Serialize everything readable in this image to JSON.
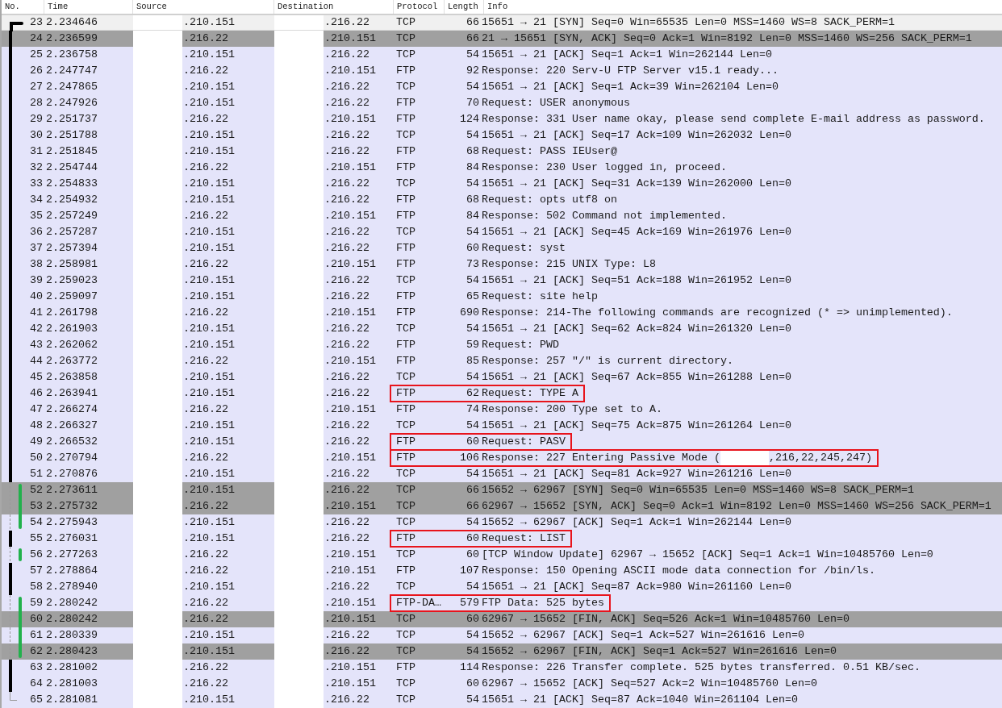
{
  "columns": [
    "No.",
    "Time",
    "Source",
    "Destination",
    "Protocol",
    "Length",
    "Info"
  ],
  "packets": [
    {
      "no": "23",
      "time": "2.234646",
      "source": ".210.151",
      "destination": ".216.22",
      "protocol": "TCP",
      "length": "66",
      "info": "15651 → 21 [SYN] Seq=0 Win=65535 Len=0 MSS=1460 WS=8 SACK_PERM=1",
      "color": "#f0f0f0",
      "selected": true,
      "highlighted": false,
      "kind": "start"
    },
    {
      "no": "24",
      "time": "2.236599",
      "source": ".216.22",
      "destination": ".210.151",
      "protocol": "TCP",
      "length": "66",
      "info": "21 → 15651 [SYN, ACK] Seq=0 Ack=1 Win=8192 Len=0 MSS=1460 WS=256 SACK_PERM=1",
      "color": "#a0a0a0",
      "selected": false,
      "highlighted": false,
      "kind": "same"
    },
    {
      "no": "25",
      "time": "2.236758",
      "source": ".210.151",
      "destination": ".216.22",
      "protocol": "TCP",
      "length": "54",
      "info": "15651 → 21 [ACK] Seq=1 Ack=1 Win=262144 Len=0",
      "color": "#e4e4fa",
      "selected": false,
      "highlighted": false,
      "kind": "same"
    },
    {
      "no": "26",
      "time": "2.247747",
      "source": ".216.22",
      "destination": ".210.151",
      "protocol": "FTP",
      "length": "92",
      "info": "Response: 220 Serv-U FTP Server v15.1 ready...",
      "color": "#e4e4fa",
      "selected": false,
      "highlighted": false,
      "kind": "same"
    },
    {
      "no": "27",
      "time": "2.247865",
      "source": ".210.151",
      "destination": ".216.22",
      "protocol": "TCP",
      "length": "54",
      "info": "15651 → 21 [ACK] Seq=1 Ack=39 Win=262104 Len=0",
      "color": "#e4e4fa",
      "selected": false,
      "highlighted": false,
      "kind": "same"
    },
    {
      "no": "28",
      "time": "2.247926",
      "source": ".210.151",
      "destination": ".216.22",
      "protocol": "FTP",
      "length": "70",
      "info": "Request: USER anonymous",
      "color": "#e4e4fa",
      "selected": false,
      "highlighted": false,
      "kind": "same"
    },
    {
      "no": "29",
      "time": "2.251737",
      "source": ".216.22",
      "destination": ".210.151",
      "protocol": "FTP",
      "length": "124",
      "info": "Response: 331 User name okay, please send complete E-mail address as password.",
      "color": "#e4e4fa",
      "selected": false,
      "highlighted": false,
      "kind": "same"
    },
    {
      "no": "30",
      "time": "2.251788",
      "source": ".210.151",
      "destination": ".216.22",
      "protocol": "TCP",
      "length": "54",
      "info": "15651 → 21 [ACK] Seq=17 Ack=109 Win=262032 Len=0",
      "color": "#e4e4fa",
      "selected": false,
      "highlighted": false,
      "kind": "same"
    },
    {
      "no": "31",
      "time": "2.251845",
      "source": ".210.151",
      "destination": ".216.22",
      "protocol": "FTP",
      "length": "68",
      "info": "Request: PASS IEUser@",
      "color": "#e4e4fa",
      "selected": false,
      "highlighted": false,
      "kind": "same"
    },
    {
      "no": "32",
      "time": "2.254744",
      "source": ".216.22",
      "destination": ".210.151",
      "protocol": "FTP",
      "length": "84",
      "info": "Response: 230 User logged in, proceed.",
      "color": "#e4e4fa",
      "selected": false,
      "highlighted": false,
      "kind": "same"
    },
    {
      "no": "33",
      "time": "2.254833",
      "source": ".210.151",
      "destination": ".216.22",
      "protocol": "TCP",
      "length": "54",
      "info": "15651 → 21 [ACK] Seq=31 Ack=139 Win=262000 Len=0",
      "color": "#e4e4fa",
      "selected": false,
      "highlighted": false,
      "kind": "same"
    },
    {
      "no": "34",
      "time": "2.254932",
      "source": ".210.151",
      "destination": ".216.22",
      "protocol": "FTP",
      "length": "68",
      "info": "Request: opts utf8 on",
      "color": "#e4e4fa",
      "selected": false,
      "highlighted": false,
      "kind": "same"
    },
    {
      "no": "35",
      "time": "2.257249",
      "source": ".216.22",
      "destination": ".210.151",
      "protocol": "FTP",
      "length": "84",
      "info": "Response: 502 Command not implemented.",
      "color": "#e4e4fa",
      "selected": false,
      "highlighted": false,
      "kind": "same"
    },
    {
      "no": "36",
      "time": "2.257287",
      "source": ".210.151",
      "destination": ".216.22",
      "protocol": "TCP",
      "length": "54",
      "info": "15651 → 21 [ACK] Seq=45 Ack=169 Win=261976 Len=0",
      "color": "#e4e4fa",
      "selected": false,
      "highlighted": false,
      "kind": "same"
    },
    {
      "no": "37",
      "time": "2.257394",
      "source": ".210.151",
      "destination": ".216.22",
      "protocol": "FTP",
      "length": "60",
      "info": "Request: syst",
      "color": "#e4e4fa",
      "selected": false,
      "highlighted": false,
      "kind": "same"
    },
    {
      "no": "38",
      "time": "2.258981",
      "source": ".216.22",
      "destination": ".210.151",
      "protocol": "FTP",
      "length": "73",
      "info": "Response: 215 UNIX Type: L8",
      "color": "#e4e4fa",
      "selected": false,
      "highlighted": false,
      "kind": "same"
    },
    {
      "no": "39",
      "time": "2.259023",
      "source": ".210.151",
      "destination": ".216.22",
      "protocol": "TCP",
      "length": "54",
      "info": "15651 → 21 [ACK] Seq=51 Ack=188 Win=261952 Len=0",
      "color": "#e4e4fa",
      "selected": false,
      "highlighted": false,
      "kind": "same"
    },
    {
      "no": "40",
      "time": "2.259097",
      "source": ".210.151",
      "destination": ".216.22",
      "protocol": "FTP",
      "length": "65",
      "info": "Request: site help",
      "color": "#e4e4fa",
      "selected": false,
      "highlighted": false,
      "kind": "same"
    },
    {
      "no": "41",
      "time": "2.261798",
      "source": ".216.22",
      "destination": ".210.151",
      "protocol": "FTP",
      "length": "690",
      "info": "Response: 214-The following commands are recognized (* => unimplemented).",
      "color": "#e4e4fa",
      "selected": false,
      "highlighted": false,
      "kind": "same"
    },
    {
      "no": "42",
      "time": "2.261903",
      "source": ".210.151",
      "destination": ".216.22",
      "protocol": "TCP",
      "length": "54",
      "info": "15651 → 21 [ACK] Seq=62 Ack=824 Win=261320 Len=0",
      "color": "#e4e4fa",
      "selected": false,
      "highlighted": false,
      "kind": "same"
    },
    {
      "no": "43",
      "time": "2.262062",
      "source": ".210.151",
      "destination": ".216.22",
      "protocol": "FTP",
      "length": "59",
      "info": "Request: PWD",
      "color": "#e4e4fa",
      "selected": false,
      "highlighted": false,
      "kind": "same"
    },
    {
      "no": "44",
      "time": "2.263772",
      "source": ".216.22",
      "destination": ".210.151",
      "protocol": "FTP",
      "length": "85",
      "info": "Response: 257 \"/\" is current directory.",
      "color": "#e4e4fa",
      "selected": false,
      "highlighted": false,
      "kind": "same"
    },
    {
      "no": "45",
      "time": "2.263858",
      "source": ".210.151",
      "destination": ".216.22",
      "protocol": "TCP",
      "length": "54",
      "info": "15651 → 21 [ACK] Seq=67 Ack=855 Win=261288 Len=0",
      "color": "#e4e4fa",
      "selected": false,
      "highlighted": false,
      "kind": "same"
    },
    {
      "no": "46",
      "time": "2.263941",
      "source": ".210.151",
      "destination": ".216.22",
      "protocol": "FTP",
      "length": "62",
      "info": "Request: TYPE A",
      "color": "#e4e4fa",
      "selected": false,
      "highlighted": true,
      "kind": "same"
    },
    {
      "no": "47",
      "time": "2.266274",
      "source": ".216.22",
      "destination": ".210.151",
      "protocol": "FTP",
      "length": "74",
      "info": "Response: 200 Type set to A.",
      "color": "#e4e4fa",
      "selected": false,
      "highlighted": false,
      "kind": "same"
    },
    {
      "no": "48",
      "time": "2.266327",
      "source": ".210.151",
      "destination": ".216.22",
      "protocol": "TCP",
      "length": "54",
      "info": "15651 → 21 [ACK] Seq=75 Ack=875 Win=261264 Len=0",
      "color": "#e4e4fa",
      "selected": false,
      "highlighted": false,
      "kind": "same"
    },
    {
      "no": "49",
      "time": "2.266532",
      "source": ".210.151",
      "destination": ".216.22",
      "protocol": "FTP",
      "length": "60",
      "info": "Request: PASV",
      "color": "#e4e4fa",
      "selected": false,
      "highlighted": true,
      "kind": "same"
    },
    {
      "no": "50",
      "time": "2.270794",
      "source": ".216.22",
      "destination": ".210.151",
      "protocol": "FTP",
      "length": "106",
      "info": "Response: 227 Entering Passive Mode (",
      "info_tail": ",216,22,245,247)",
      "color": "#e4e4fa",
      "selected": false,
      "highlighted": true,
      "kind": "same"
    },
    {
      "no": "51",
      "time": "2.270876",
      "source": ".210.151",
      "destination": ".216.22",
      "protocol": "TCP",
      "length": "54",
      "info": "15651 → 21 [ACK] Seq=81 Ack=927 Win=261216 Len=0",
      "color": "#e4e4fa",
      "selected": false,
      "highlighted": false,
      "kind": "same"
    },
    {
      "no": "52",
      "time": "2.273611",
      "source": ".210.151",
      "destination": ".216.22",
      "protocol": "TCP",
      "length": "66",
      "info": "15652 → 62967 [SYN] Seq=0 Win=65535 Len=0 MSS=1460 WS=8 SACK_PERM=1",
      "color": "#a0a0a0",
      "selected": false,
      "highlighted": false,
      "kind": "other-top"
    },
    {
      "no": "53",
      "time": "2.275732",
      "source": ".216.22",
      "destination": ".210.151",
      "protocol": "TCP",
      "length": "66",
      "info": "62967 → 15652 [SYN, ACK] Seq=0 Ack=1 Win=8192 Len=0 MSS=1460 WS=256 SACK_PERM=1",
      "color": "#a0a0a0",
      "selected": false,
      "highlighted": false,
      "kind": "other-mid"
    },
    {
      "no": "54",
      "time": "2.275943",
      "source": ".210.151",
      "destination": ".216.22",
      "protocol": "TCP",
      "length": "54",
      "info": "15652 → 62967 [ACK] Seq=1 Ack=1 Win=262144 Len=0",
      "color": "#e4e4fa",
      "selected": false,
      "highlighted": false,
      "kind": "other-bottom"
    },
    {
      "no": "55",
      "time": "2.276031",
      "source": ".210.151",
      "destination": ".216.22",
      "protocol": "FTP",
      "length": "60",
      "info": "Request: LIST",
      "color": "#e4e4fa",
      "selected": false,
      "highlighted": true,
      "kind": "same"
    },
    {
      "no": "56",
      "time": "2.277263",
      "source": ".216.22",
      "destination": ".210.151",
      "protocol": "TCP",
      "length": "60",
      "info": "[TCP Window Update] 62967 → 15652 [ACK] Seq=1 Ack=1 Win=10485760 Len=0",
      "color": "#e4e4fa",
      "selected": false,
      "highlighted": false,
      "kind": "other-single"
    },
    {
      "no": "57",
      "time": "2.278864",
      "source": ".216.22",
      "destination": ".210.151",
      "protocol": "FTP",
      "length": "107",
      "info": "Response: 150 Opening ASCII mode data connection for /bin/ls.",
      "color": "#e4e4fa",
      "selected": false,
      "highlighted": false,
      "kind": "same"
    },
    {
      "no": "58",
      "time": "2.278940",
      "source": ".210.151",
      "destination": ".216.22",
      "protocol": "TCP",
      "length": "54",
      "info": "15651 → 21 [ACK] Seq=87 Ack=980 Win=261160 Len=0",
      "color": "#e4e4fa",
      "selected": false,
      "highlighted": false,
      "kind": "same"
    },
    {
      "no": "59",
      "time": "2.280242",
      "source": ".216.22",
      "destination": ".210.151",
      "protocol": "FTP-DA…",
      "length": "579",
      "info": "FTP Data: 525 bytes",
      "color": "#e4e4fa",
      "selected": false,
      "highlighted": true,
      "kind": "other-top"
    },
    {
      "no": "60",
      "time": "2.280242",
      "source": ".216.22",
      "destination": ".210.151",
      "protocol": "TCP",
      "length": "60",
      "info": "62967 → 15652 [FIN, ACK] Seq=526 Ack=1 Win=10485760 Len=0",
      "color": "#a0a0a0",
      "selected": false,
      "highlighted": false,
      "kind": "other-mid"
    },
    {
      "no": "61",
      "time": "2.280339",
      "source": ".210.151",
      "destination": ".216.22",
      "protocol": "TCP",
      "length": "54",
      "info": "15652 → 62967 [ACK] Seq=1 Ack=527 Win=261616 Len=0",
      "color": "#e4e4fa",
      "selected": false,
      "highlighted": false,
      "kind": "other-mid"
    },
    {
      "no": "62",
      "time": "2.280423",
      "source": ".210.151",
      "destination": ".216.22",
      "protocol": "TCP",
      "length": "54",
      "info": "15652 → 62967 [FIN, ACK] Seq=1 Ack=527 Win=261616 Len=0",
      "color": "#a0a0a0",
      "selected": false,
      "highlighted": false,
      "kind": "other-bottom"
    },
    {
      "no": "63",
      "time": "2.281002",
      "source": ".216.22",
      "destination": ".210.151",
      "protocol": "FTP",
      "length": "114",
      "info": "Response: 226 Transfer complete. 525 bytes transferred. 0.51 KB/sec.",
      "color": "#e4e4fa",
      "selected": false,
      "highlighted": false,
      "kind": "same"
    },
    {
      "no": "64",
      "time": "2.281003",
      "source": ".216.22",
      "destination": ".210.151",
      "protocol": "TCP",
      "length": "60",
      "info": "62967 → 15652 [ACK] Seq=527 Ack=2 Win=10485760 Len=0",
      "color": "#e4e4fa",
      "selected": false,
      "highlighted": false,
      "kind": "same"
    },
    {
      "no": "65",
      "time": "2.281081",
      "source": ".210.151",
      "destination": ".216.22",
      "protocol": "TCP",
      "length": "54",
      "info": "15651 → 21 [ACK] Seq=87 Ack=1040 Win=261104 Len=0",
      "color": "#e4e4fa",
      "selected": false,
      "highlighted": false,
      "kind": "end"
    }
  ]
}
